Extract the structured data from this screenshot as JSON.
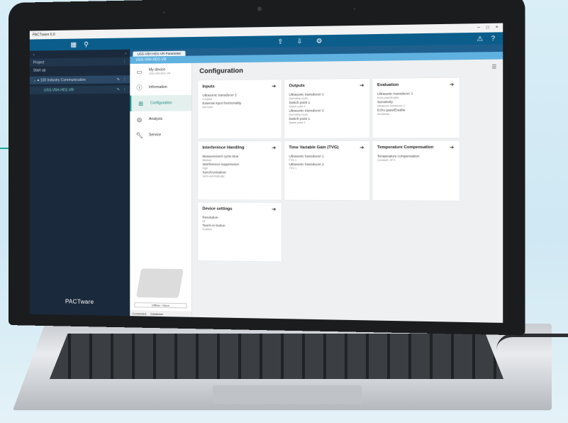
{
  "app": {
    "window_title": "PACTware 6.0",
    "window_controls": [
      "–",
      "□",
      "×"
    ],
    "brand": "PACTware"
  },
  "sidebar": {
    "header": "Project",
    "subheader": "Start up",
    "items": [
      {
        "label": "100 Industry Communication"
      },
      {
        "label": "USS-V5H-HD1-VR"
      }
    ]
  },
  "tabs": [
    {
      "label": "USS-V5H-HD1-VR Parameter"
    }
  ],
  "device_bar": {
    "label": "USS-V5H-HD1-VR"
  },
  "nav": {
    "device_name": "My device",
    "device_sub": "USS-V5H-HD1-VR",
    "items": [
      {
        "label": "Information",
        "icon": "info-icon"
      },
      {
        "label": "Configuration",
        "icon": "config-icon",
        "active": true
      },
      {
        "label": "Analysis",
        "icon": "analysis-icon"
      },
      {
        "label": "Service",
        "icon": "wrench-icon"
      }
    ],
    "device_caption": "Offline / Store",
    "status": [
      "Connected",
      "Database"
    ]
  },
  "content": {
    "title": "Configuration",
    "cards": [
      {
        "title": "Inputs",
        "lines": [
          "Ultrasonic transducer 2",
          "Coupled",
          "External input functionality",
          "Not used"
        ]
      },
      {
        "title": "Outputs",
        "lines": [
          "Ultrasonic transducer 1",
          "Operating mode",
          "Switch point 1",
          "Switch point 2",
          "Ultrasonic transducer 2",
          "Operating mode",
          "Switch point 1",
          "Switch point 2"
        ]
      },
      {
        "title": "Evaluation",
        "lines": [
          "Ultrasonic transducer 1",
          "Echo pass/Enable",
          "Sensitivity",
          "Ultrasonic transducer 2",
          "Echo pass/Enable",
          "Sensitivity"
        ]
      },
      {
        "title": "Interference Handling",
        "lines": [
          "Measurement cycle time",
          "Medium",
          "Interference suppression",
          "High",
          "Synchronisation",
          "Semi-automatically"
        ]
      },
      {
        "title": "Time Variable Gain (TVG)",
        "lines": [
          "Ultrasonic transducer 1",
          "TVG 1",
          "Ultrasonic transducer 2",
          "TVG 1"
        ]
      },
      {
        "title": "Temperature Compensation",
        "lines": [
          "Temperature compensation",
          "Constant: 20°C"
        ]
      },
      {
        "title": "Device settings",
        "lines": [
          "Resolution",
          "off",
          "Teach-in button",
          "Enabled"
        ]
      }
    ]
  },
  "colors": {
    "accent": "#1aa693",
    "topbar": "#0b5e8c",
    "sidebar": "#1a2a3c"
  }
}
